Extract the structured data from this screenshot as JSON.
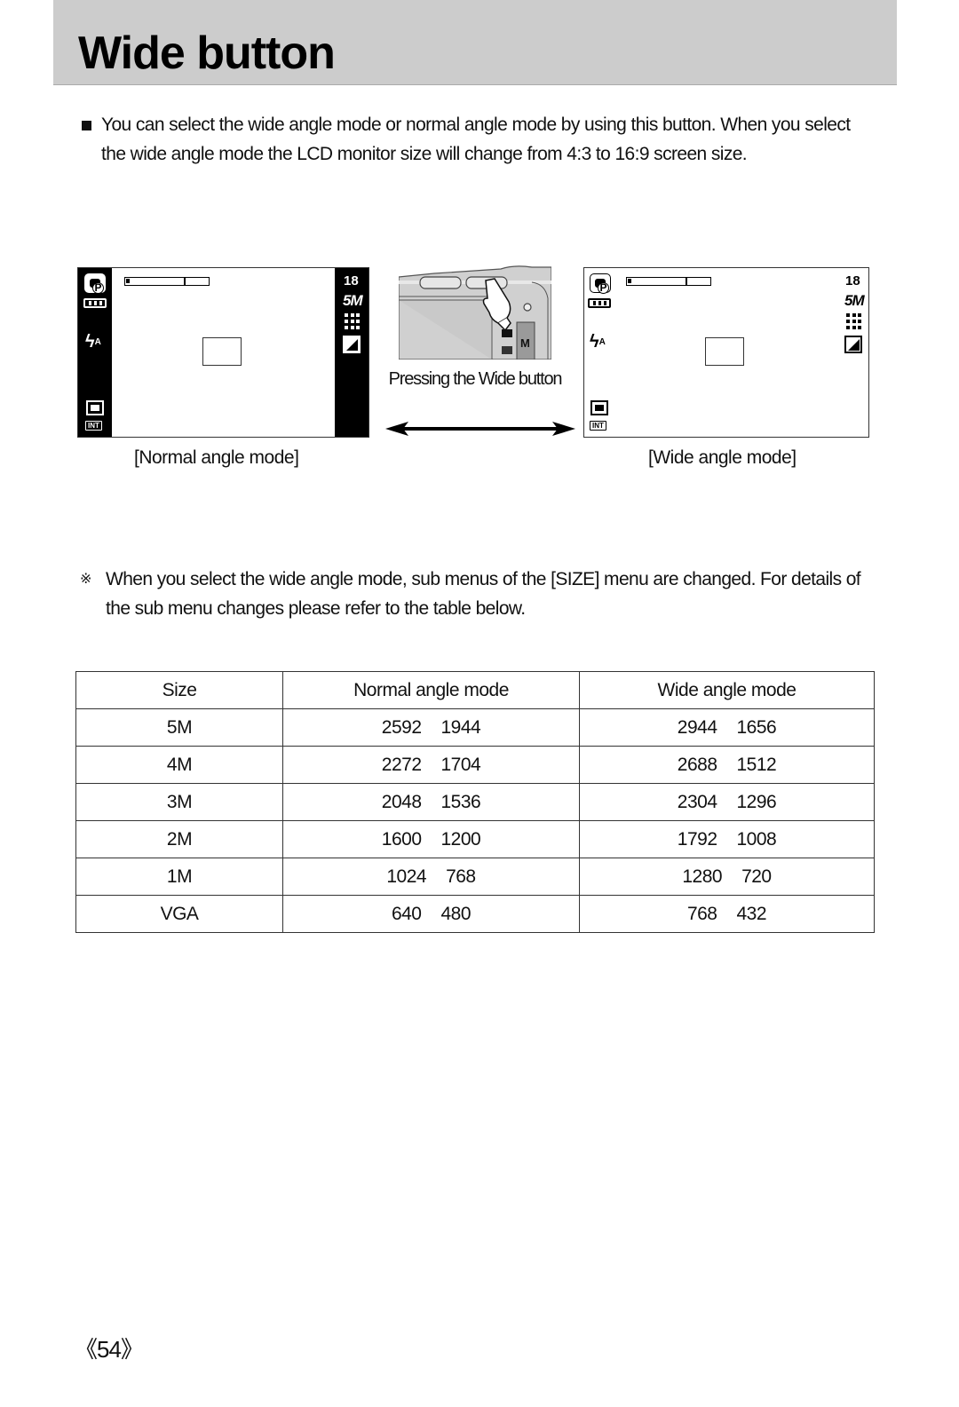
{
  "header": {
    "title": "Wide button"
  },
  "intro": {
    "bullet_icon": "square-bullet-icon",
    "text": "You can select the wide angle mode or normal angle mode by using this button. When you select the wide angle mode the LCD monitor size will change from 4:3 to 16:9 screen size."
  },
  "illustration": {
    "normal_lcd": {
      "caption": "[Normal angle mode]",
      "shots_remaining": "18",
      "image_size": "5M",
      "mode_badge": "P",
      "storage": "INT"
    },
    "wide_lcd": {
      "caption": "[Wide angle mode]",
      "shots_remaining": "18",
      "image_size": "5M",
      "mode_badge": "P",
      "storage": "INT"
    },
    "camera_caption": "Pressing the Wide button",
    "camera_mode_label": "M",
    "arrow_icon": "double-arrow-icon"
  },
  "note": {
    "mark": "※",
    "text": "When you select the wide angle mode, sub menus of the [SIZE] menu are changed. For details of the sub menu changes please refer to the table below."
  },
  "size_table": {
    "headers": [
      "Size",
      "Normal angle mode",
      "Wide angle mode"
    ],
    "rows": [
      {
        "size": "5M",
        "normal": [
          "2592",
          "1944"
        ],
        "wide": [
          "2944",
          "1656"
        ]
      },
      {
        "size": "4M",
        "normal": [
          "2272",
          "1704"
        ],
        "wide": [
          "2688",
          "1512"
        ]
      },
      {
        "size": "3M",
        "normal": [
          "2048",
          "1536"
        ],
        "wide": [
          "2304",
          "1296"
        ]
      },
      {
        "size": "2M",
        "normal": [
          "1600",
          "1200"
        ],
        "wide": [
          "1792",
          "1008"
        ]
      },
      {
        "size": "1M",
        "normal": [
          "1024",
          "768"
        ],
        "wide": [
          "1280",
          "720"
        ]
      },
      {
        "size": "VGA",
        "normal": [
          "640",
          "480"
        ],
        "wide": [
          "768",
          "432"
        ]
      }
    ]
  },
  "footer": {
    "page_number": "《54》"
  }
}
